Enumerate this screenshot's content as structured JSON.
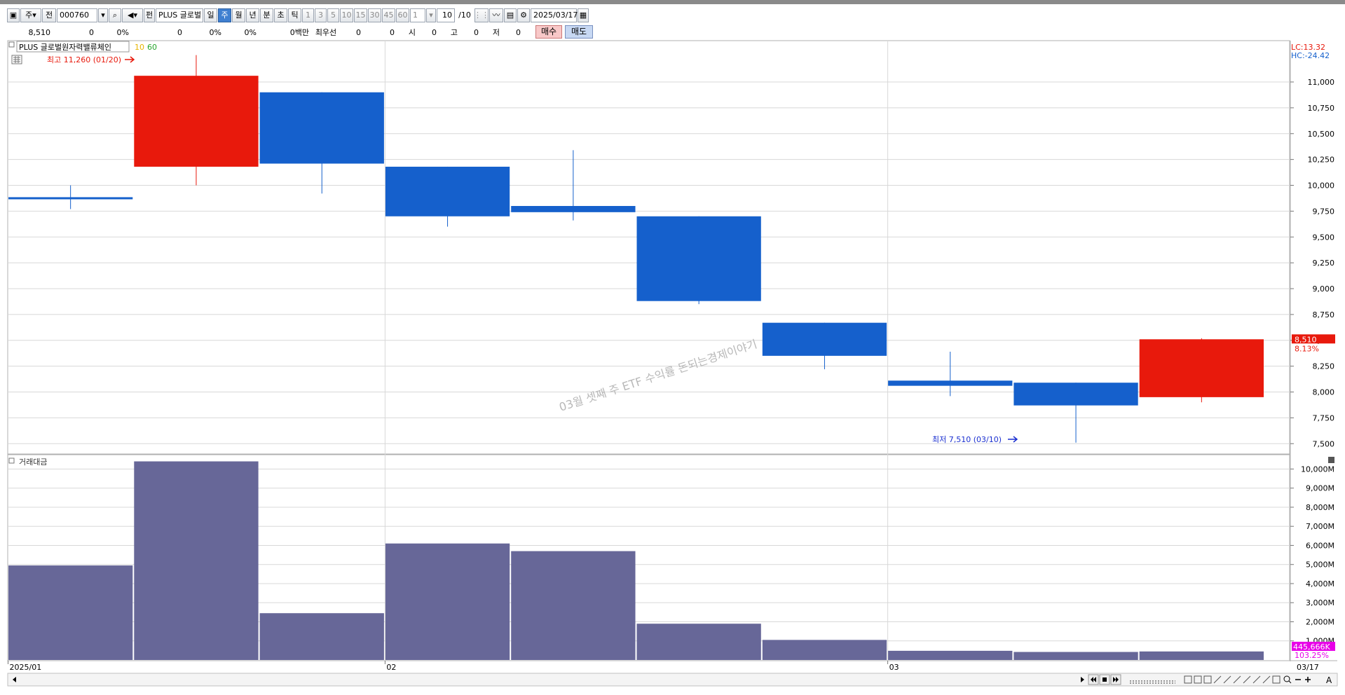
{
  "toolbar": {
    "type_label": "주",
    "market_label": "전",
    "code_value": "000760",
    "name_prefix": "펀",
    "name_value": "PLUS 글로벌",
    "periods": [
      "일",
      "주",
      "월",
      "년",
      "분",
      "초",
      "틱"
    ],
    "selected_period": "주",
    "numbers": [
      "1",
      "3",
      "5",
      "10",
      "15",
      "30",
      "45",
      "60"
    ],
    "count_value": "1",
    "page_value": "10",
    "page_total": "/10",
    "date_value": "2025/03/17"
  },
  "infobar": {
    "price": "8,510",
    "change": "0",
    "change_pct": "0%",
    "vol": "0",
    "vol_pct": "0%",
    "amt_pct": "0%",
    "amount": "0백만",
    "bid_label": "최우선",
    "bid1": "0",
    "bid2": "0",
    "open_label": "시",
    "open_value": "0",
    "high_label": "고",
    "high_value": "0",
    "low_label": "저",
    "low_value": "0",
    "buy_label": "매수",
    "sell_label": "매도"
  },
  "price_panel": {
    "title": "PLUS 글로벌원자력밸류체인",
    "ma1": "10",
    "ma2": "60",
    "high_note": "최고 11,260 (01/20)",
    "low_note": "최저 7,510 (03/10)",
    "lc": "LC:13.32",
    "hc": "HC:-24.42",
    "current_price": "8,510",
    "current_pct": "8.13%",
    "watermark": "03월 셋째 주 ETF 수익률 돈되는경제이야기"
  },
  "volume_panel": {
    "title": "거래대금",
    "current_value": "445,666K",
    "current_pct": "103.25%"
  },
  "xaxis": {
    "labels": [
      "2025/01",
      "02",
      "03"
    ],
    "end_label": "03/17"
  },
  "chart_data": {
    "type": "candlestick",
    "title": "PLUS 글로벌원자력밸류체인",
    "candles": [
      {
        "open": 9870,
        "close": 9885,
        "high": 10000,
        "low": 9770,
        "color": "down"
      },
      {
        "open": 10180,
        "close": 11060,
        "high": 11260,
        "low": 10000,
        "color": "up"
      },
      {
        "open": 10900,
        "close": 10210,
        "high": 10900,
        "low": 9920,
        "color": "down"
      },
      {
        "open": 10180,
        "close": 9700,
        "high": 10180,
        "low": 9600,
        "color": "down"
      },
      {
        "open": 9800,
        "close": 9740,
        "high": 10340,
        "low": 9660,
        "color": "down"
      },
      {
        "open": 9700,
        "close": 8880,
        "high": 9700,
        "low": 8850,
        "color": "down"
      },
      {
        "open": 8670,
        "close": 8350,
        "high": 8670,
        "low": 8220,
        "color": "down"
      },
      {
        "open": 8110,
        "close": 8060,
        "high": 8390,
        "low": 7960,
        "color": "down"
      },
      {
        "open": 8090,
        "close": 7870,
        "high": 8090,
        "low": 7510,
        "color": "down"
      },
      {
        "open": 7950,
        "close": 8510,
        "high": 8520,
        "low": 7900,
        "color": "up"
      }
    ],
    "volume_values_M": [
      4950,
      10400,
      2450,
      6100,
      5700,
      1900,
      1050,
      480,
      420,
      445.666
    ],
    "price_ticks": [
      "11,000",
      "10,750",
      "10,500",
      "10,250",
      "10,000",
      "9,750",
      "9,500",
      "9,250",
      "9,000",
      "8,750",
      "8,500",
      "8,250",
      "8,000",
      "7,750",
      "7,500"
    ],
    "price_tick_values": [
      11000,
      10750,
      10500,
      10250,
      10000,
      9750,
      9500,
      9250,
      9000,
      8750,
      8500,
      8250,
      8000,
      7750,
      7500
    ],
    "volume_ticks": [
      "10,000M",
      "9,000M",
      "8,000M",
      "7,000M",
      "6,000M",
      "5,000M",
      "4,000M",
      "3,000M",
      "2,000M",
      "1,000M"
    ],
    "volume_tick_values": [
      10000,
      9000,
      8000,
      7000,
      6000,
      5000,
      4000,
      3000,
      2000,
      1000
    ],
    "ylim_price": [
      7400,
      11400
    ],
    "ylim_volume": [
      0,
      10750
    ],
    "month_starts": [
      0,
      3,
      7
    ],
    "colors": {
      "up": "#e8190c",
      "down": "#1560cc",
      "volume": "#676798",
      "grid": "#d8d8d8",
      "high_note": "#e8190c",
      "low_note": "#1a2fd0"
    }
  }
}
